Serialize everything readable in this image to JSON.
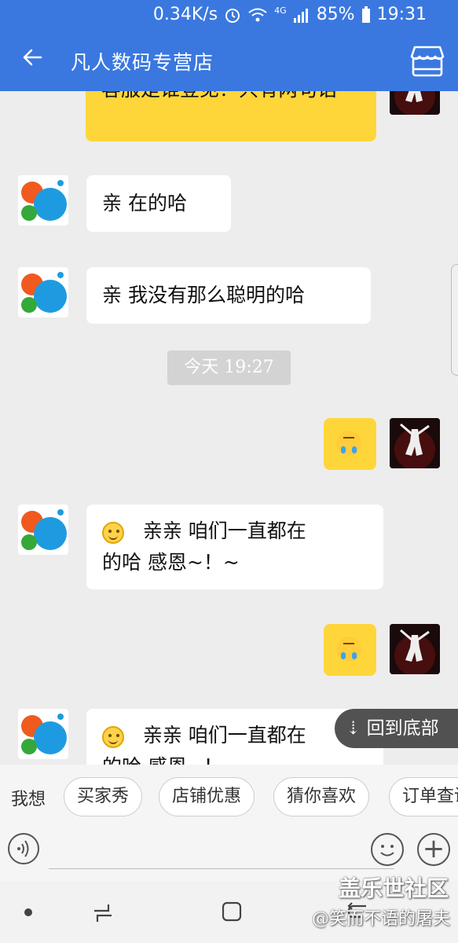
{
  "status_bar": {
    "speed": "0.34K/s",
    "network": "4G",
    "battery": "85%",
    "time": "19:31"
  },
  "header": {
    "title": "凡人数码专营店",
    "back_icon": "back-arrow-icon",
    "store_icon": "store-icon"
  },
  "messages": [
    {
      "from": "me",
      "type": "text",
      "text": "客服是谁登见？只有两句话",
      "partial": true
    },
    {
      "from": "shop",
      "type": "text",
      "text": "亲 在的哈"
    },
    {
      "from": "shop",
      "type": "text",
      "text": "亲 我没有那么聪明的哈"
    },
    {
      "from": "system",
      "type": "time",
      "text": "今天 19:27"
    },
    {
      "from": "me",
      "type": "emoji",
      "emoji": "crying-face-icon"
    },
    {
      "from": "shop",
      "type": "text",
      "text_line1": "亲亲  咱们一直都在",
      "text_line2": "的哈 感恩~！~"
    },
    {
      "from": "me",
      "type": "emoji",
      "emoji": "crying-face-icon"
    },
    {
      "from": "shop",
      "type": "text",
      "text_line1": "亲亲  咱们一直都在",
      "text_line2": "的哈 感恩~！~"
    }
  ],
  "back_to_bottom": "⇣ 回到底部",
  "quick_bar": {
    "label": "我想",
    "chips": [
      "买家秀",
      "店铺优惠",
      "猜你喜欢",
      "订单查询"
    ]
  },
  "input_bar": {
    "voice_icon": "voice-icon",
    "emoji_icon": "smiley-icon",
    "plus_icon": "plus-icon"
  },
  "watermark": {
    "line1": "盖乐世社区",
    "line2": "@笑而不语的屠夫"
  }
}
